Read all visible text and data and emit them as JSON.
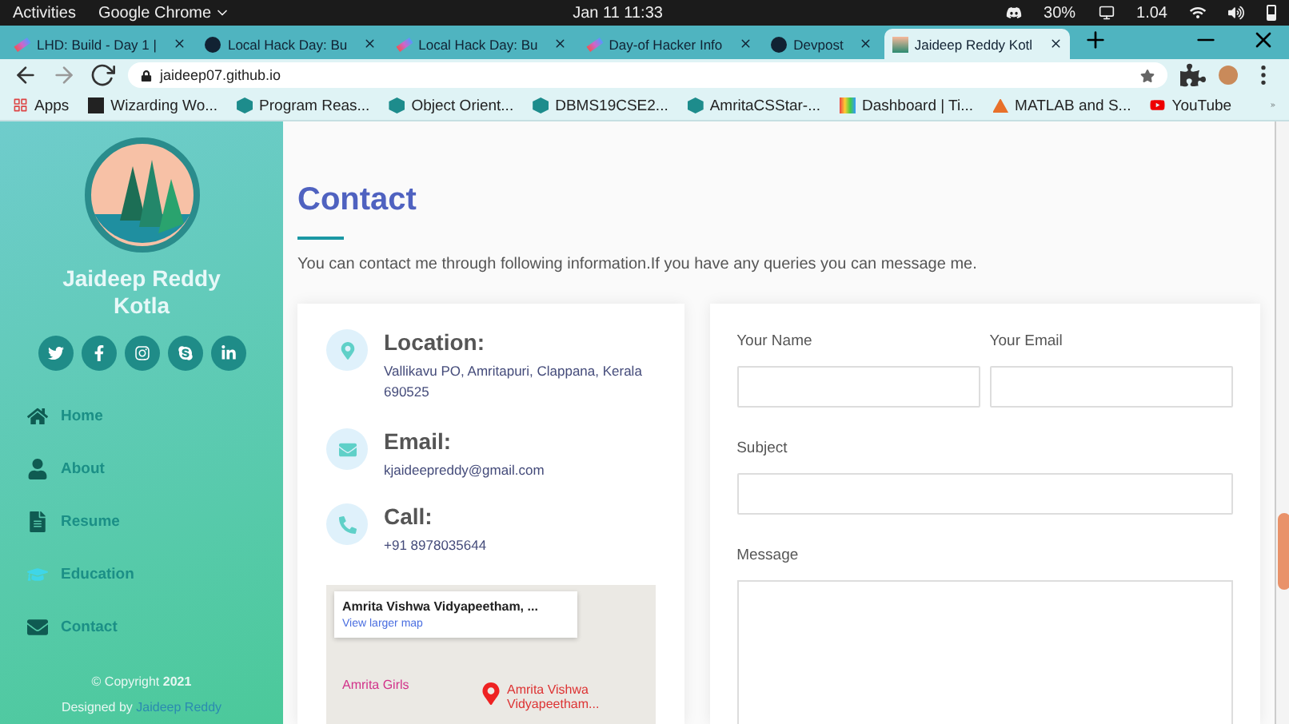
{
  "system_bar": {
    "activities": "Activities",
    "app": "Google Chrome",
    "clock": "Jan 11  11:33",
    "battery": "30%",
    "display": "1.04"
  },
  "tabs": [
    {
      "title": "LHD: Build - Day 1 |",
      "selected": false,
      "kind": "hack"
    },
    {
      "title": "Local Hack Day: Bu",
      "selected": false,
      "kind": "devpost"
    },
    {
      "title": "Local Hack Day: Bu",
      "selected": false,
      "kind": "hack"
    },
    {
      "title": "Day-of Hacker Info",
      "selected": false,
      "kind": "hack"
    },
    {
      "title": "Devpost",
      "selected": false,
      "kind": "devpost"
    },
    {
      "title": "Jaideep Reddy Kotl",
      "selected": true,
      "kind": "site"
    }
  ],
  "address": {
    "url": "jaideep07.github.io"
  },
  "bookmarks": [
    {
      "label": "Apps",
      "kind": "apps"
    },
    {
      "label": "Wizarding Wo...",
      "kind": "w"
    },
    {
      "label": "Program Reas...",
      "kind": "s"
    },
    {
      "label": "Object Orient...",
      "kind": "s"
    },
    {
      "label": "DBMS19CSE2...",
      "kind": "s"
    },
    {
      "label": "AmritaCSStar-...",
      "kind": "s"
    },
    {
      "label": "Dashboard | Ti...",
      "kind": "grid"
    },
    {
      "label": "MATLAB and S...",
      "kind": "matlab"
    },
    {
      "label": "YouTube",
      "kind": "yt"
    }
  ],
  "sidebar": {
    "name": "Jaideep Reddy Kotla",
    "socials": [
      {
        "kind": "twitter"
      },
      {
        "kind": "facebook"
      },
      {
        "kind": "instagram"
      },
      {
        "kind": "skype"
      },
      {
        "kind": "linkedin"
      }
    ],
    "nav": [
      {
        "label": "Home",
        "kind": "home",
        "selected": false
      },
      {
        "label": "About",
        "kind": "user",
        "selected": false
      },
      {
        "label": "Resume",
        "kind": "file",
        "selected": false
      },
      {
        "label": "Education",
        "kind": "cap",
        "selected": true
      },
      {
        "label": "Contact",
        "kind": "mail",
        "selected": false
      }
    ],
    "copyright": "© Copyright",
    "year": "2021",
    "designed_by": "Designed by",
    "designer": "Jaideep Reddy"
  },
  "section": {
    "title": "Contact",
    "description": "You can contact me through following information.If you have any queries you can message me."
  },
  "info": [
    {
      "kind": "location",
      "title": "Location:",
      "value": "Vallikavu PO, Amritapuri, Clappana, Kerala 690525"
    },
    {
      "kind": "email",
      "title": "Email:",
      "value": "kjaideepreddy@gmail.com"
    },
    {
      "kind": "call",
      "title": "Call:",
      "value": "+91 8978035644"
    }
  ],
  "map": {
    "place": "Amrita Vishwa Vidyapeetham, ...",
    "link": "View larger map",
    "pin_label": "Amrita Vishwa Vidyapeetham...",
    "poi": "Amrita Girls"
  },
  "form": {
    "fields": [
      {
        "label": "Your Name",
        "kind": "half"
      },
      {
        "label": "Your Email",
        "kind": "half"
      },
      {
        "label": "Subject",
        "kind": "full"
      },
      {
        "label": "Message",
        "kind": "area"
      }
    ]
  }
}
